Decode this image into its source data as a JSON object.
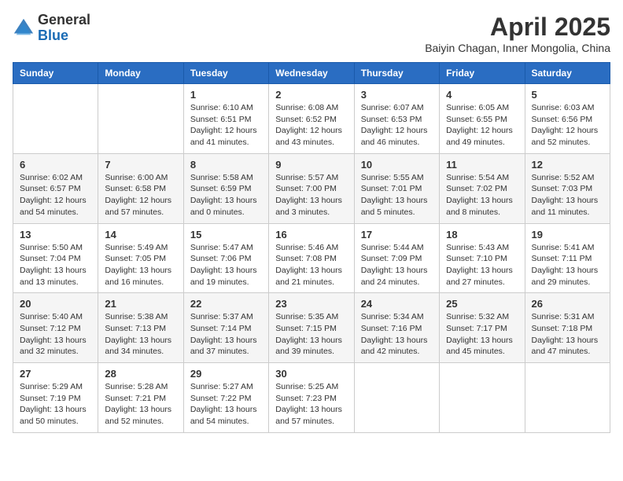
{
  "logo": {
    "general": "General",
    "blue": "Blue"
  },
  "header": {
    "month": "April 2025",
    "location": "Baiyin Chagan, Inner Mongolia, China"
  },
  "weekdays": [
    "Sunday",
    "Monday",
    "Tuesday",
    "Wednesday",
    "Thursday",
    "Friday",
    "Saturday"
  ],
  "weeks": [
    [
      {
        "day": "",
        "info": ""
      },
      {
        "day": "",
        "info": ""
      },
      {
        "day": "1",
        "info": "Sunrise: 6:10 AM\nSunset: 6:51 PM\nDaylight: 12 hours and 41 minutes."
      },
      {
        "day": "2",
        "info": "Sunrise: 6:08 AM\nSunset: 6:52 PM\nDaylight: 12 hours and 43 minutes."
      },
      {
        "day": "3",
        "info": "Sunrise: 6:07 AM\nSunset: 6:53 PM\nDaylight: 12 hours and 46 minutes."
      },
      {
        "day": "4",
        "info": "Sunrise: 6:05 AM\nSunset: 6:55 PM\nDaylight: 12 hours and 49 minutes."
      },
      {
        "day": "5",
        "info": "Sunrise: 6:03 AM\nSunset: 6:56 PM\nDaylight: 12 hours and 52 minutes."
      }
    ],
    [
      {
        "day": "6",
        "info": "Sunrise: 6:02 AM\nSunset: 6:57 PM\nDaylight: 12 hours and 54 minutes."
      },
      {
        "day": "7",
        "info": "Sunrise: 6:00 AM\nSunset: 6:58 PM\nDaylight: 12 hours and 57 minutes."
      },
      {
        "day": "8",
        "info": "Sunrise: 5:58 AM\nSunset: 6:59 PM\nDaylight: 13 hours and 0 minutes."
      },
      {
        "day": "9",
        "info": "Sunrise: 5:57 AM\nSunset: 7:00 PM\nDaylight: 13 hours and 3 minutes."
      },
      {
        "day": "10",
        "info": "Sunrise: 5:55 AM\nSunset: 7:01 PM\nDaylight: 13 hours and 5 minutes."
      },
      {
        "day": "11",
        "info": "Sunrise: 5:54 AM\nSunset: 7:02 PM\nDaylight: 13 hours and 8 minutes."
      },
      {
        "day": "12",
        "info": "Sunrise: 5:52 AM\nSunset: 7:03 PM\nDaylight: 13 hours and 11 minutes."
      }
    ],
    [
      {
        "day": "13",
        "info": "Sunrise: 5:50 AM\nSunset: 7:04 PM\nDaylight: 13 hours and 13 minutes."
      },
      {
        "day": "14",
        "info": "Sunrise: 5:49 AM\nSunset: 7:05 PM\nDaylight: 13 hours and 16 minutes."
      },
      {
        "day": "15",
        "info": "Sunrise: 5:47 AM\nSunset: 7:06 PM\nDaylight: 13 hours and 19 minutes."
      },
      {
        "day": "16",
        "info": "Sunrise: 5:46 AM\nSunset: 7:08 PM\nDaylight: 13 hours and 21 minutes."
      },
      {
        "day": "17",
        "info": "Sunrise: 5:44 AM\nSunset: 7:09 PM\nDaylight: 13 hours and 24 minutes."
      },
      {
        "day": "18",
        "info": "Sunrise: 5:43 AM\nSunset: 7:10 PM\nDaylight: 13 hours and 27 minutes."
      },
      {
        "day": "19",
        "info": "Sunrise: 5:41 AM\nSunset: 7:11 PM\nDaylight: 13 hours and 29 minutes."
      }
    ],
    [
      {
        "day": "20",
        "info": "Sunrise: 5:40 AM\nSunset: 7:12 PM\nDaylight: 13 hours and 32 minutes."
      },
      {
        "day": "21",
        "info": "Sunrise: 5:38 AM\nSunset: 7:13 PM\nDaylight: 13 hours and 34 minutes."
      },
      {
        "day": "22",
        "info": "Sunrise: 5:37 AM\nSunset: 7:14 PM\nDaylight: 13 hours and 37 minutes."
      },
      {
        "day": "23",
        "info": "Sunrise: 5:35 AM\nSunset: 7:15 PM\nDaylight: 13 hours and 39 minutes."
      },
      {
        "day": "24",
        "info": "Sunrise: 5:34 AM\nSunset: 7:16 PM\nDaylight: 13 hours and 42 minutes."
      },
      {
        "day": "25",
        "info": "Sunrise: 5:32 AM\nSunset: 7:17 PM\nDaylight: 13 hours and 45 minutes."
      },
      {
        "day": "26",
        "info": "Sunrise: 5:31 AM\nSunset: 7:18 PM\nDaylight: 13 hours and 47 minutes."
      }
    ],
    [
      {
        "day": "27",
        "info": "Sunrise: 5:29 AM\nSunset: 7:19 PM\nDaylight: 13 hours and 50 minutes."
      },
      {
        "day": "28",
        "info": "Sunrise: 5:28 AM\nSunset: 7:21 PM\nDaylight: 13 hours and 52 minutes."
      },
      {
        "day": "29",
        "info": "Sunrise: 5:27 AM\nSunset: 7:22 PM\nDaylight: 13 hours and 54 minutes."
      },
      {
        "day": "30",
        "info": "Sunrise: 5:25 AM\nSunset: 7:23 PM\nDaylight: 13 hours and 57 minutes."
      },
      {
        "day": "",
        "info": ""
      },
      {
        "day": "",
        "info": ""
      },
      {
        "day": "",
        "info": ""
      }
    ]
  ]
}
